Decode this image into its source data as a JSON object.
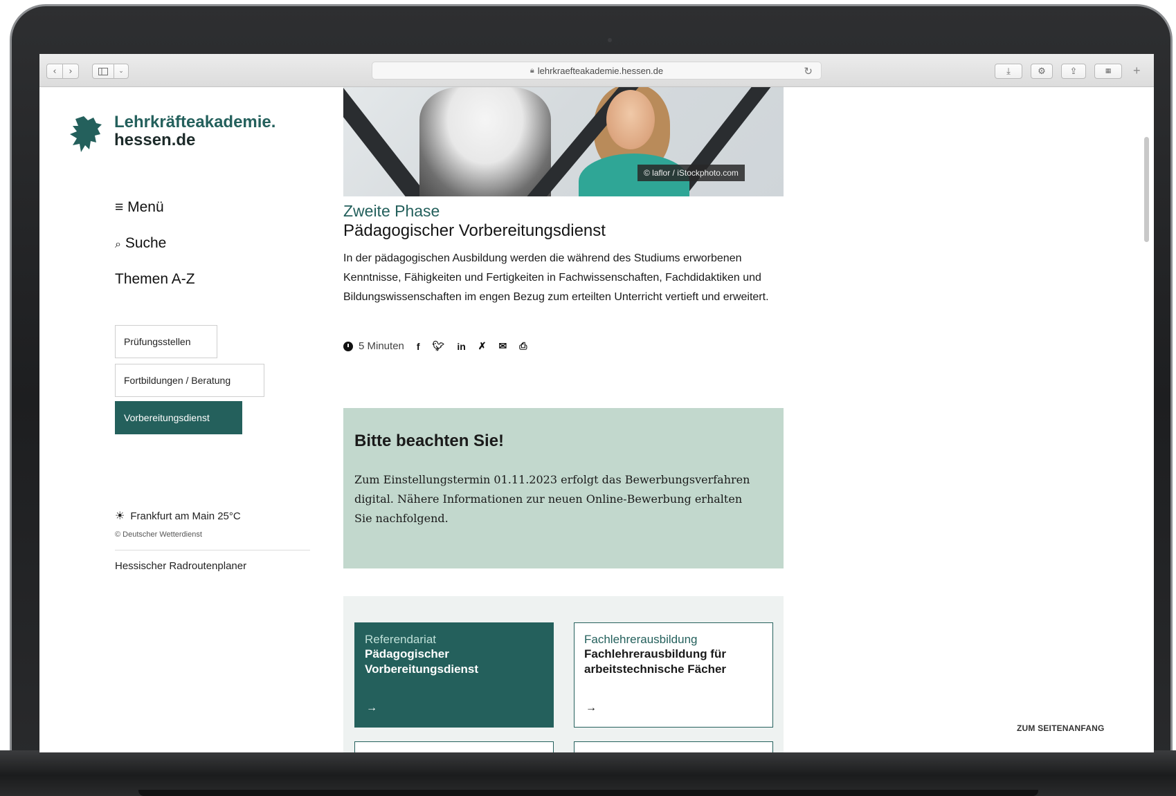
{
  "browser": {
    "url": "lehrkraefteakademie.hessen.de",
    "back_icon": "chevron-left",
    "forward_icon": "chevron-right",
    "sidebar_icon": "sidebar",
    "reload_icon": "reload"
  },
  "site": {
    "logo_line1": "Lehrkräfteakademie.",
    "logo_line2": "hessen.de",
    "accent_color": "#24605c"
  },
  "nav": {
    "menu_label": "≡ Menü",
    "search_label": "Suche",
    "az_label": "Themen A-Z"
  },
  "sidebar_buttons": [
    {
      "label": "Prüfungsstellen"
    },
    {
      "label": "Fortbildungen / Beratung"
    },
    {
      "label": "Vorbereitungsdienst",
      "active": true
    }
  ],
  "weather": {
    "location": "Frankfurt am Main",
    "temperature": "25°C",
    "source": "© Deutscher Wetterdienst"
  },
  "links": {
    "radrouten": "Hessischer Radroutenplaner"
  },
  "hero": {
    "credit": "© laflor / iStockphoto.com"
  },
  "article": {
    "kicker": "Zweite Phase",
    "title": "Pädagogischer Vorbereitungsdienst",
    "intro": "In der pädagogischen Ausbildung werden die während des Studiums erworbenen Kenntnisse, Fähigkeiten und Fertigkeiten in Fachwissenschaften, Fachdidaktiken und Bildungswissenschaften im engen Bezug zum erteilten Unterricht vertieft und erweitert.",
    "reading_time": "5 Minuten",
    "share_icons": [
      "facebook-icon",
      "twitter-icon",
      "linkedin-icon",
      "xing-icon",
      "mail-icon",
      "print-icon"
    ]
  },
  "notice": {
    "heading": "Bitte beachten Sie!",
    "text": "Zum Einstellungstermin 01.11.2023 erfolgt das Bewerbungsverfahren digital. Nähere Informationen zur neuen Online-Bewerbung erhalten Sie nachfolgend.",
    "background": "#c2d8cd"
  },
  "cards": [
    {
      "sub": "Referendariat",
      "title": "Pädagogischer Vorbereitungsdienst",
      "arrow": "→"
    },
    {
      "sub": "Fachlehrerausbildung",
      "title": "Fachlehrerausbildung für arbeitstechnische Fächer",
      "arrow": "→"
    }
  ],
  "footer": {
    "to_top": "ZUM SEITENANFANG"
  }
}
